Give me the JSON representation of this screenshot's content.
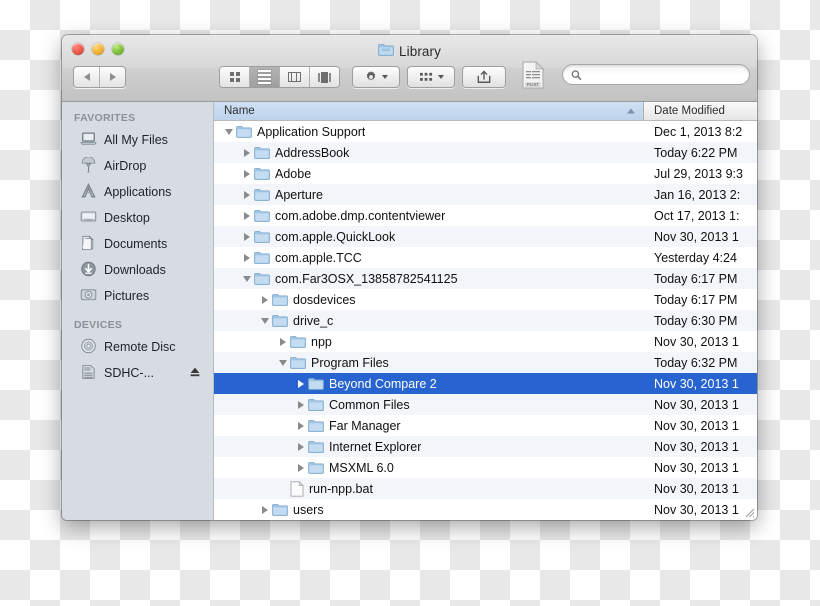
{
  "window": {
    "title": "Library",
    "title_icon": "folder-icon",
    "traffic_lights": [
      "close",
      "minimize",
      "zoom"
    ]
  },
  "toolbar": {
    "back_label": "Back",
    "forward_label": "Forward",
    "view_modes": [
      {
        "name": "icon-view",
        "icon": "grid-icon",
        "active": false
      },
      {
        "name": "list-view",
        "icon": "list-icon",
        "active": true
      },
      {
        "name": "column-view",
        "icon": "columns-icon",
        "active": false
      },
      {
        "name": "coverflow-view",
        "icon": "coverflow-icon",
        "active": false
      }
    ],
    "action_button": {
      "icon": "gear-icon",
      "label": ""
    },
    "arrange_button": {
      "icon": "arrange-icon",
      "label": ""
    },
    "share_button": {
      "icon": "share-icon",
      "label": ""
    },
    "plist_icon": "plist-file-icon",
    "search": {
      "value": "",
      "placeholder": "",
      "icon": "search-icon"
    }
  },
  "sidebar": {
    "sections": [
      {
        "header": "FAVORITES",
        "items": [
          {
            "label": "All My Files",
            "icon": "all-my-files-icon"
          },
          {
            "label": "AirDrop",
            "icon": "airdrop-icon"
          },
          {
            "label": "Applications",
            "icon": "applications-icon"
          },
          {
            "label": "Desktop",
            "icon": "desktop-icon"
          },
          {
            "label": "Documents",
            "icon": "documents-icon"
          },
          {
            "label": "Downloads",
            "icon": "downloads-icon"
          },
          {
            "label": "Pictures",
            "icon": "pictures-icon"
          }
        ]
      },
      {
        "header": "DEVICES",
        "items": [
          {
            "label": "Remote Disc",
            "icon": "remote-disc-icon"
          },
          {
            "label": "SDHC-...",
            "icon": "sd-card-icon",
            "eject": true
          }
        ]
      }
    ]
  },
  "file_list": {
    "columns": [
      {
        "label": "Name",
        "sorted": true,
        "sort_direction": "ascending"
      },
      {
        "label": "Date Modified",
        "sorted": false
      }
    ],
    "rows": [
      {
        "name": "Application Support",
        "date": "Dec 1, 2013 8:2",
        "depth": 0,
        "type": "folder",
        "state": "open",
        "selected": false
      },
      {
        "name": "AddressBook",
        "date": "Today 6:22 PM",
        "depth": 1,
        "type": "folder",
        "state": "closed",
        "selected": false
      },
      {
        "name": "Adobe",
        "date": "Jul 29, 2013 9:3",
        "depth": 1,
        "type": "folder",
        "state": "closed",
        "selected": false
      },
      {
        "name": "Aperture",
        "date": "Jan 16, 2013 2:",
        "depth": 1,
        "type": "folder",
        "state": "closed",
        "selected": false
      },
      {
        "name": "com.adobe.dmp.contentviewer",
        "date": "Oct 17, 2013 1:",
        "depth": 1,
        "type": "folder",
        "state": "closed",
        "selected": false
      },
      {
        "name": "com.apple.QuickLook",
        "date": "Nov 30, 2013 1",
        "depth": 1,
        "type": "folder",
        "state": "closed",
        "selected": false
      },
      {
        "name": "com.apple.TCC",
        "date": "Yesterday 4:24",
        "depth": 1,
        "type": "folder",
        "state": "closed",
        "selected": false
      },
      {
        "name": "com.Far3OSX_13858782541125",
        "date": "Today 6:17 PM",
        "depth": 1,
        "type": "folder",
        "state": "open",
        "selected": false
      },
      {
        "name": "dosdevices",
        "date": "Today 6:17 PM",
        "depth": 2,
        "type": "folder",
        "state": "closed",
        "selected": false
      },
      {
        "name": "drive_c",
        "date": "Today 6:30 PM",
        "depth": 2,
        "type": "folder",
        "state": "open",
        "selected": false
      },
      {
        "name": "npp",
        "date": "Nov 30, 2013 1",
        "depth": 3,
        "type": "folder",
        "state": "closed",
        "selected": false
      },
      {
        "name": "Program Files",
        "date": "Today 6:32 PM",
        "depth": 3,
        "type": "folder",
        "state": "open",
        "selected": false
      },
      {
        "name": "Beyond Compare 2",
        "date": "Nov 30, 2013 1",
        "depth": 4,
        "type": "folder",
        "state": "closed",
        "selected": true
      },
      {
        "name": "Common Files",
        "date": "Nov 30, 2013 1",
        "depth": 4,
        "type": "folder",
        "state": "closed",
        "selected": false
      },
      {
        "name": "Far Manager",
        "date": "Nov 30, 2013 1",
        "depth": 4,
        "type": "folder",
        "state": "closed",
        "selected": false
      },
      {
        "name": "Internet Explorer",
        "date": "Nov 30, 2013 1",
        "depth": 4,
        "type": "folder",
        "state": "closed",
        "selected": false
      },
      {
        "name": "MSXML 6.0",
        "date": "Nov 30, 2013 1",
        "depth": 4,
        "type": "folder",
        "state": "closed",
        "selected": false
      },
      {
        "name": "run-npp.bat",
        "date": "Nov 30, 2013 1",
        "depth": 3,
        "type": "file",
        "state": "none",
        "selected": false
      },
      {
        "name": "users",
        "date": "Nov 30, 2013 1",
        "depth": 2,
        "type": "folder",
        "state": "closed",
        "selected": false
      }
    ]
  },
  "colors": {
    "selection": "#2864cf",
    "sidebar_bg": "#d7dce2",
    "header_name_bg": "#bdd3ec",
    "stripe": "#f2f5f9"
  }
}
